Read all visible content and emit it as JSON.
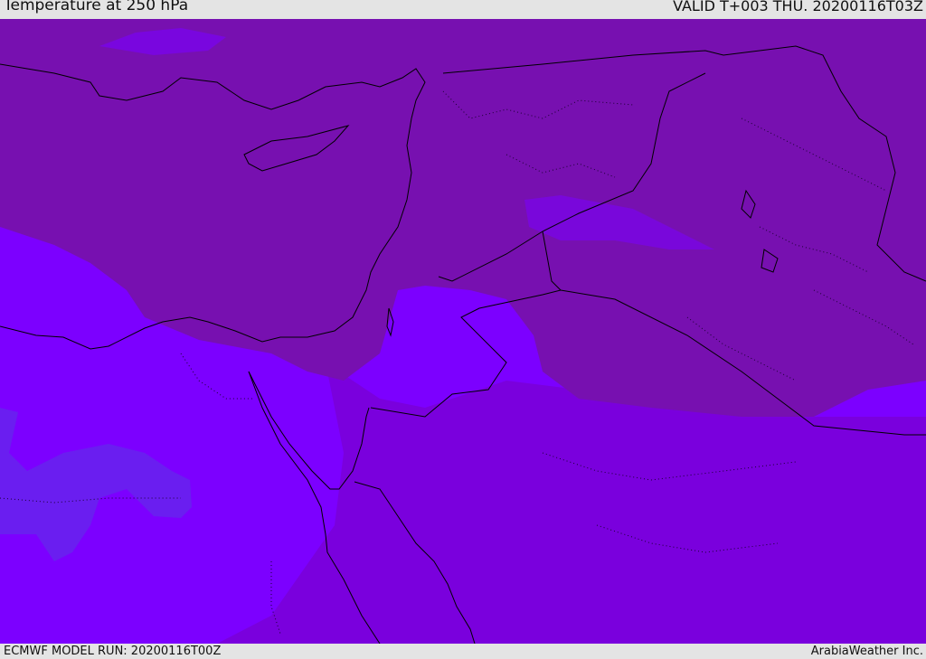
{
  "header": {
    "title": "Temperature at 250 hPa",
    "valid": "VALID T+003 THU. 20200116T03Z"
  },
  "footer": {
    "model_run": "ECMWF MODEL RUN: 20200116T00Z",
    "credit": "ArabiaWeather Inc."
  },
  "colors": {
    "cold_band": "#7710b0",
    "mid_band": "#7c00ff",
    "south_band": "#7a00dd",
    "patch_blue": "#6a1ef0",
    "coastline": "#000000"
  }
}
